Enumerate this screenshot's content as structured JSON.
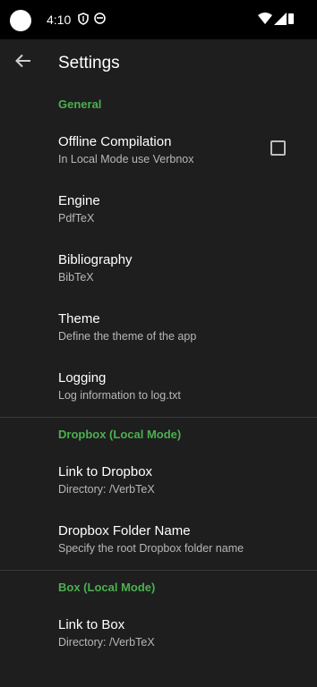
{
  "status": {
    "time": "4:10"
  },
  "appbar": {
    "title": "Settings"
  },
  "sections": [
    {
      "header": "General",
      "items": [
        {
          "title": "Offline Compilation",
          "summary": "In Local Mode use Verbnox",
          "checkbox": true,
          "checked": false
        },
        {
          "title": "Engine",
          "summary": "PdfTeX"
        },
        {
          "title": "Bibliography",
          "summary": "BibTeX"
        },
        {
          "title": "Theme",
          "summary": "Define the theme of the app"
        },
        {
          "title": "Logging",
          "summary": "Log information to log.txt"
        }
      ]
    },
    {
      "header": "Dropbox (Local Mode)",
      "items": [
        {
          "title": "Link to Dropbox",
          "summary": "Directory: /VerbTeX"
        },
        {
          "title": "Dropbox Folder Name",
          "summary": "Specify the root Dropbox folder name"
        }
      ]
    },
    {
      "header": "Box (Local Mode)",
      "items": [
        {
          "title": "Link to Box",
          "summary": "Directory: /VerbTeX"
        }
      ]
    }
  ],
  "colors": {
    "accent": "#4caf50",
    "background": "#1e1e1e",
    "statusbar": "#000000"
  }
}
